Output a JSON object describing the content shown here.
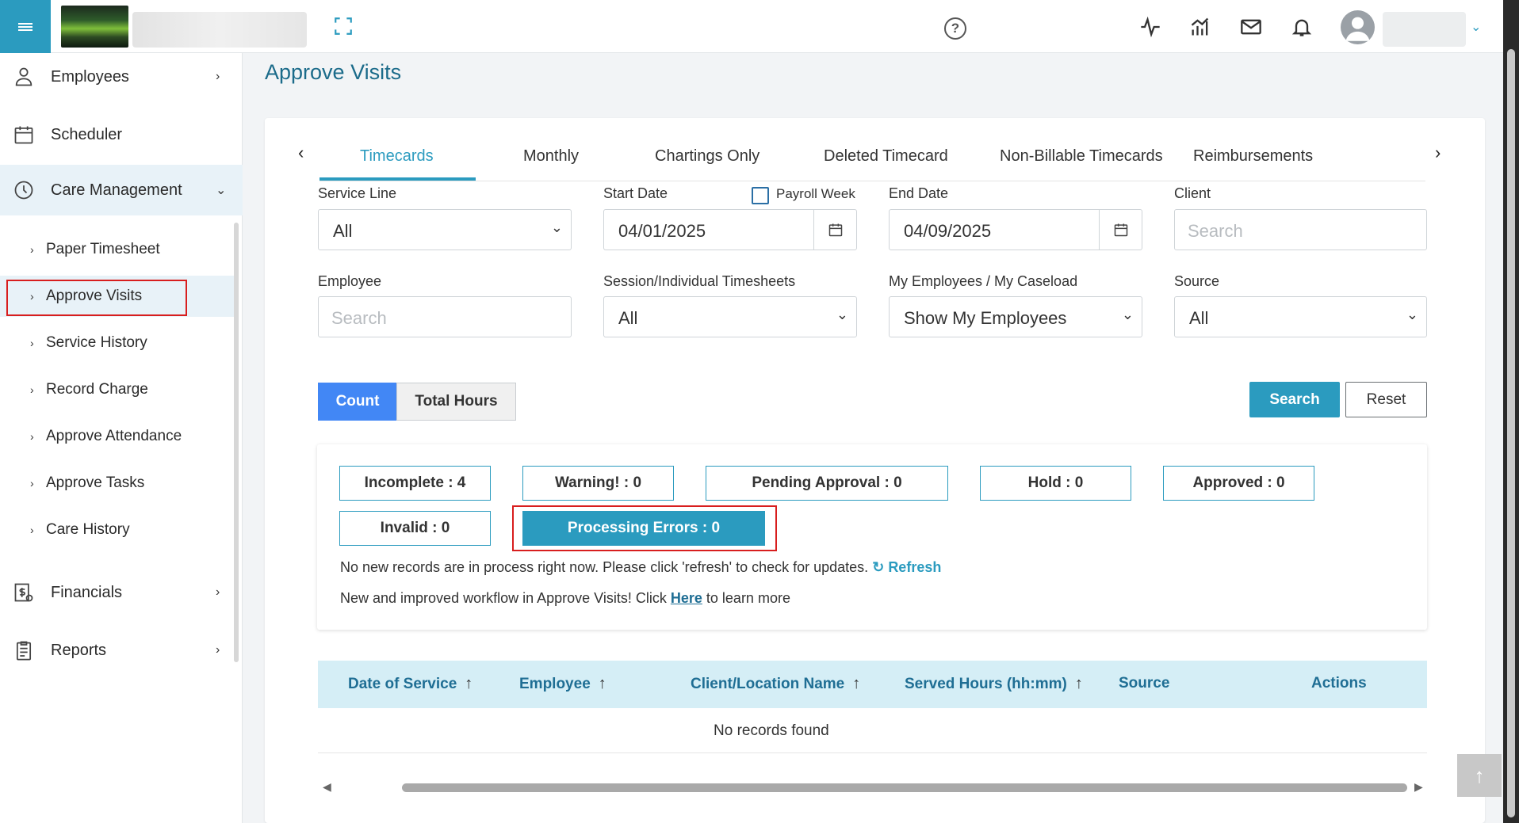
{
  "header": {
    "icons": [
      "menu-icon",
      "expand-icon",
      "help-icon",
      "activity-icon",
      "analytics-icon",
      "mail-icon",
      "bell-icon",
      "user-avatar-icon",
      "chevron-down-icon"
    ],
    "help_label": "?"
  },
  "sidebar": {
    "items": [
      {
        "label": "Employees",
        "icon": "employees-icon"
      },
      {
        "label": "Scheduler",
        "icon": "calendar-icon"
      },
      {
        "label": "Care Management",
        "icon": "clock-icon"
      },
      {
        "label": "Financials",
        "icon": "financials-icon"
      },
      {
        "label": "Reports",
        "icon": "clipboard-icon"
      }
    ],
    "sub_items": [
      {
        "label": "Paper Timesheet"
      },
      {
        "label": "Approve Visits"
      },
      {
        "label": "Service History"
      },
      {
        "label": "Record Charge"
      },
      {
        "label": "Approve Attendance"
      },
      {
        "label": "Approve Tasks"
      },
      {
        "label": "Care History"
      }
    ]
  },
  "page": {
    "title": "Approve Visits"
  },
  "tabs": [
    "Timecards",
    "Monthly",
    "Chartings Only",
    "Deleted Timecard",
    "Non-Billable Timecards",
    "Reimbursements"
  ],
  "filters": {
    "service_line": {
      "label": "Service Line",
      "value": "All"
    },
    "start_date": {
      "label": "Start Date",
      "value": "04/01/2025"
    },
    "payroll_week": {
      "label": "Payroll Week",
      "checked": false
    },
    "end_date": {
      "label": "End Date",
      "value": "04/09/2025"
    },
    "client": {
      "label": "Client",
      "placeholder": "Search"
    },
    "employee": {
      "label": "Employee",
      "placeholder": "Search"
    },
    "session": {
      "label": "Session/Individual Timesheets",
      "value": "All"
    },
    "caseload": {
      "label": "My Employees / My Caseload",
      "value": "Show My Employees"
    },
    "source": {
      "label": "Source",
      "value": "All"
    }
  },
  "toggle": {
    "count": "Count",
    "total_hours": "Total Hours",
    "selected": "Count"
  },
  "actions": {
    "search": "Search",
    "reset": "Reset"
  },
  "status": {
    "incomplete": "Incomplete : 4",
    "warning": "Warning! : 0",
    "pending": "Pending Approval : 0",
    "hold": "Hold : 0",
    "approved": "Approved : 0",
    "invalid": "Invalid : 0",
    "processing": "Processing Errors : 0",
    "info_text": "No new records are in process right now. Please click 'refresh' to check for updates.",
    "refresh": "Refresh",
    "workflow_pre": "New and improved workflow in Approve Visits! Click",
    "workflow_link": "Here",
    "workflow_post": "to learn more"
  },
  "table": {
    "columns": [
      "Date of Service",
      "Employee",
      "Client/Location Name",
      "Served Hours (hh:mm)",
      "Source",
      "Actions"
    ],
    "empty": "No records found"
  },
  "colors": {
    "accent": "#2b9bbf",
    "title": "#1b6b8a",
    "highlight": "#d81e1e",
    "toggle_active": "#4287f5"
  }
}
